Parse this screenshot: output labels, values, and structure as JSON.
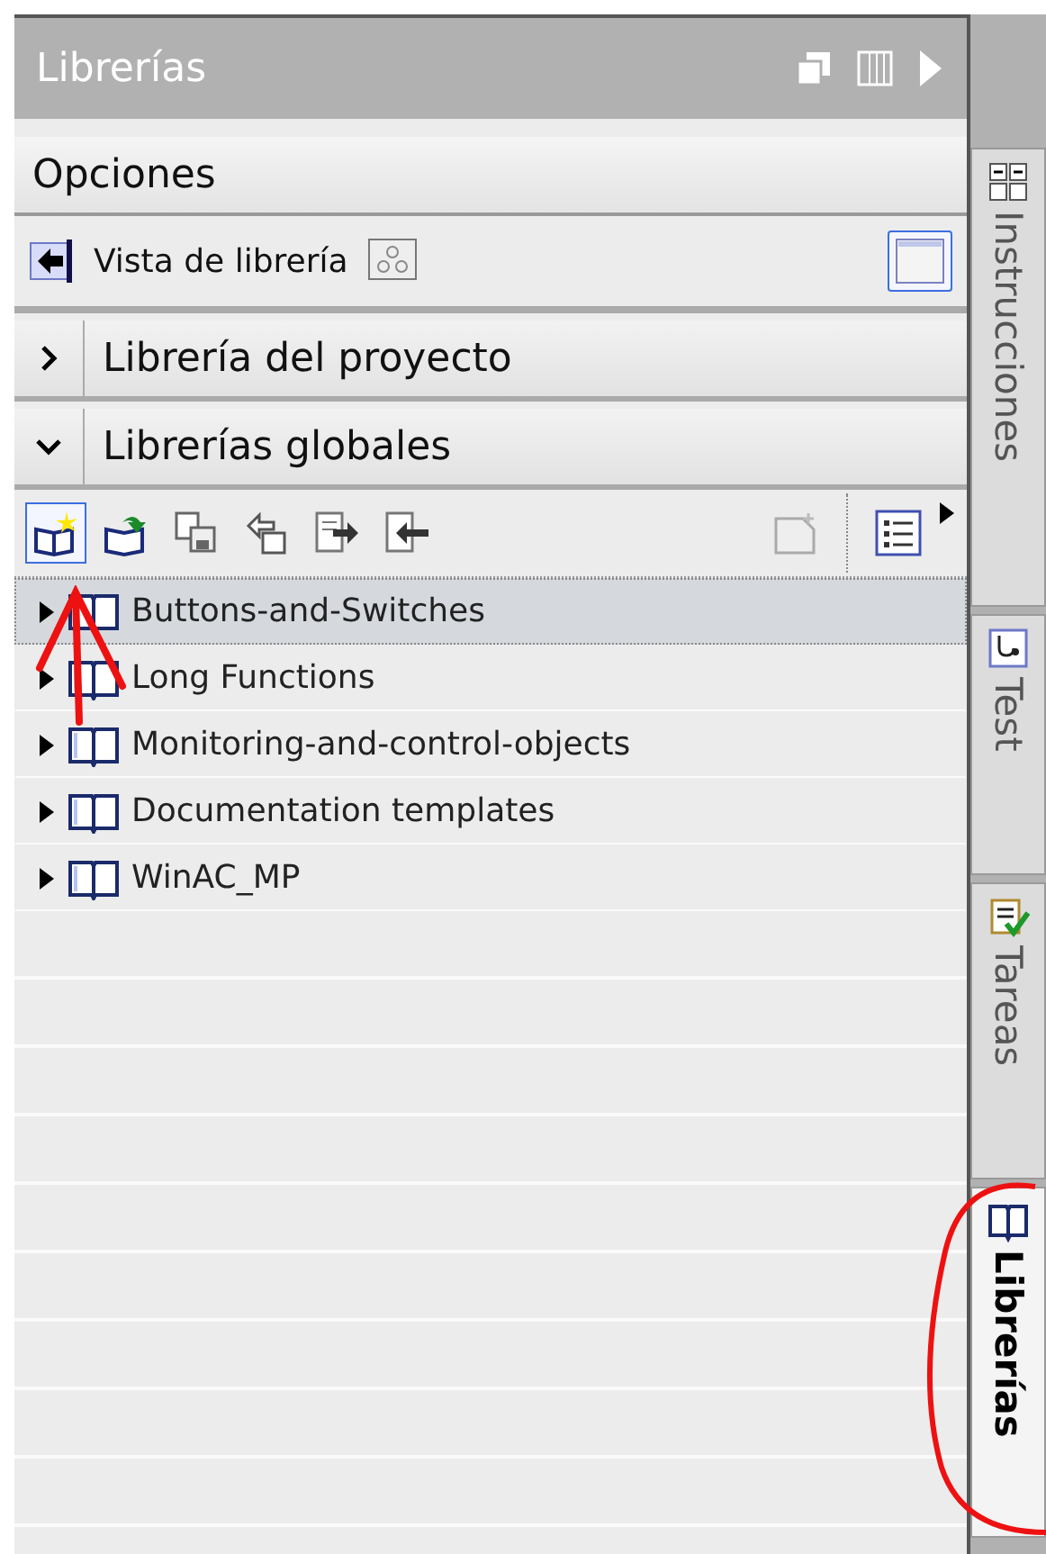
{
  "panel": {
    "title": "Librerías"
  },
  "options": {
    "title": "Opciones",
    "view_toggle": {
      "label": "Vista de librería",
      "on": true
    }
  },
  "sections": [
    {
      "label": "Librería del proyecto",
      "expanded": false
    },
    {
      "label": "Librerías globales",
      "expanded": true
    }
  ],
  "toolbar": [
    {
      "kind": "new",
      "selected": true
    },
    {
      "kind": "open",
      "selected": false
    },
    {
      "kind": "save",
      "selected": false
    },
    {
      "kind": "close",
      "selected": false
    },
    {
      "kind": "export",
      "selected": false
    },
    {
      "kind": "import",
      "selected": false
    },
    {
      "kind": "folder",
      "selected": false
    },
    {
      "kind": "list",
      "selected": false
    }
  ],
  "tree": [
    {
      "label": "Buttons-and-Switches",
      "selected": true
    },
    {
      "label": "Long Functions",
      "selected": false
    },
    {
      "label": "Monitoring-and-control-objects",
      "selected": false
    },
    {
      "label": "Documentation templates",
      "selected": false
    },
    {
      "label": "WinAC_MP",
      "selected": false
    }
  ],
  "side_tabs": [
    {
      "label": "Instrucciones",
      "kind": "grid",
      "selected": false
    },
    {
      "label": "Test",
      "kind": "probe",
      "selected": false
    },
    {
      "label": "Tareas",
      "kind": "tasks",
      "selected": false
    },
    {
      "label": "Librerías",
      "kind": "book",
      "selected": true
    }
  ]
}
